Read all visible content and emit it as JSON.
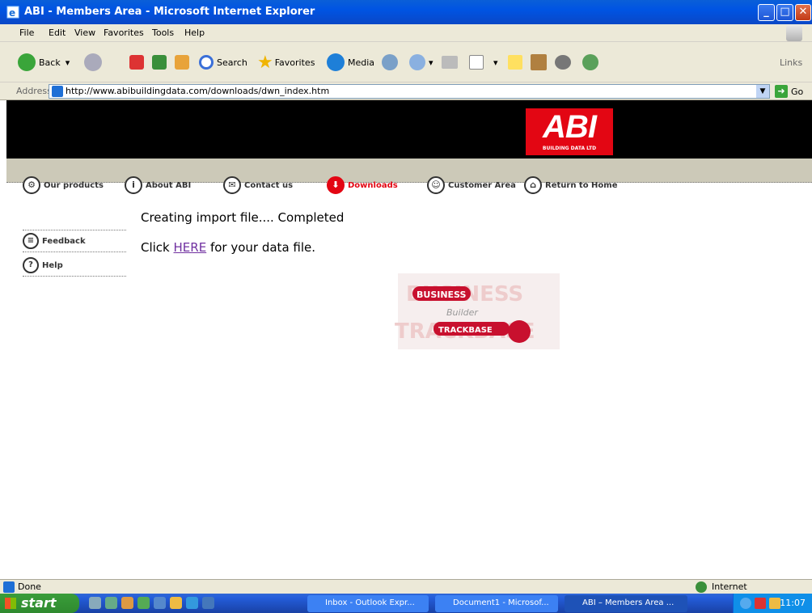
{
  "window": {
    "title": "ABI - Members Area - Microsoft Internet Explorer"
  },
  "menu": [
    "File",
    "Edit",
    "View",
    "Favorites",
    "Tools",
    "Help"
  ],
  "toolbar": {
    "back": "Back",
    "search": "Search",
    "favorites": "Favorites",
    "media": "Media",
    "links": "Links"
  },
  "address": {
    "label": "Address",
    "url": "http://www.abibuildingdata.com/downloads/dwn_index.htm",
    "go": "Go"
  },
  "page": {
    "logo_text": "ABI",
    "logo_sub": "BUILDING DATA LTD",
    "nav": [
      "Our products",
      "About ABI",
      "Contact us",
      "Downloads",
      "Customer Area",
      "Return to Home"
    ],
    "side": [
      "Feedback",
      "Help"
    ],
    "message": "Creating import file.... Completed",
    "click_prefix": "Click ",
    "click_link": "HERE",
    "click_suffix": " for your data file.",
    "promo": {
      "business": "BUSINESS",
      "builder": "Builder",
      "trackbase": "TRACKBASE"
    }
  },
  "status": {
    "text": "Done",
    "zone": "Internet"
  },
  "taskbar": {
    "start": "start",
    "tasks": [
      "Inbox - Outlook Expr...",
      "Document1 - Microsof...",
      "ABI – Members Area ..."
    ],
    "time": "11:07"
  },
  "colors": {
    "accent": "#e30613",
    "xp_blue": "#0054e3",
    "chrome": "#ece9d8"
  }
}
